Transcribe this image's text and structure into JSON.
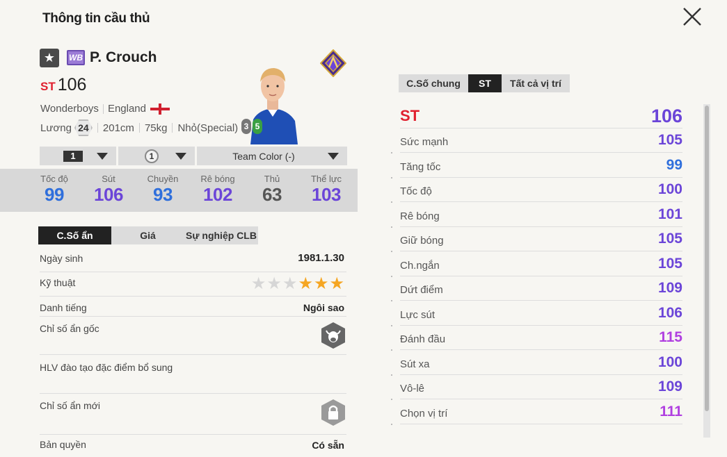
{
  "header": {
    "title": "Thông tin cầu thủ"
  },
  "player": {
    "name": "P. Crouch",
    "season_badge": "WB",
    "position": "ST",
    "overall": "106",
    "team": "Wonderboys",
    "nation": "England",
    "salary_label": "Lương",
    "salary": "24",
    "height": "201cm",
    "weight": "75kg",
    "body_type": "Nhỏ(Special)",
    "skill_moves": "3",
    "weak_foot": "5"
  },
  "dropdowns": {
    "grade": "1",
    "enhance": "1",
    "team_color": "Team Color (-)"
  },
  "summary": [
    {
      "label": "Tốc độ",
      "value": "99",
      "color": "#2f6fdc"
    },
    {
      "label": "Sút",
      "value": "106",
      "color": "#6b45d8"
    },
    {
      "label": "Chuyền",
      "value": "93",
      "color": "#2f6fdc"
    },
    {
      "label": "Rê bóng",
      "value": "102",
      "color": "#6b45d8"
    },
    {
      "label": "Thủ",
      "value": "63",
      "color": "#555555"
    },
    {
      "label": "Thể lực",
      "value": "103",
      "color": "#6b45d8"
    }
  ],
  "left_tabs": [
    "C.Số ẩn",
    "Giá",
    "Sự nghiệp CLB"
  ],
  "info": {
    "birth_label": "Ngày sinh",
    "birth_value": "1981.1.30",
    "skill_label": "Kỹ thuật",
    "skill_stars": 3,
    "fame_label": "Danh tiếng",
    "fame_value": "Ngôi sao",
    "trait_label": "Chỉ số ẩn gốc",
    "coach_label": "HLV đào tạo đặc điểm bổ sung",
    "new_trait_label": "Chỉ số ẩn mới",
    "license_label": "Bản quyền",
    "license_value": "Có sẵn"
  },
  "right_tabs": [
    "C.Số chung",
    "ST",
    "Tất cả vị trí"
  ],
  "position_rating": {
    "label": "ST",
    "value": "106"
  },
  "stats": [
    {
      "label": "Sức mạnh",
      "value": "105",
      "color": "#6b45d8"
    },
    {
      "label": "Tăng tốc",
      "value": "99",
      "color": "#2f6fdc"
    },
    {
      "label": "Tốc độ",
      "value": "100",
      "color": "#6b45d8"
    },
    {
      "label": "Rê bóng",
      "value": "101",
      "color": "#6b45d8"
    },
    {
      "label": "Giữ bóng",
      "value": "105",
      "color": "#6b45d8"
    },
    {
      "label": "Ch.ngắn",
      "value": "105",
      "color": "#6b45d8"
    },
    {
      "label": "Dứt điểm",
      "value": "109",
      "color": "#6b45d8"
    },
    {
      "label": "Lực sút",
      "value": "106",
      "color": "#6b45d8"
    },
    {
      "label": "Đánh đầu",
      "value": "115",
      "color": "#b03fe0"
    },
    {
      "label": "Sút xa",
      "value": "100",
      "color": "#6b45d8"
    },
    {
      "label": "Vô-lê",
      "value": "109",
      "color": "#6b45d8"
    },
    {
      "label": "Chọn vị trí",
      "value": "111",
      "color": "#b03fe0"
    }
  ]
}
